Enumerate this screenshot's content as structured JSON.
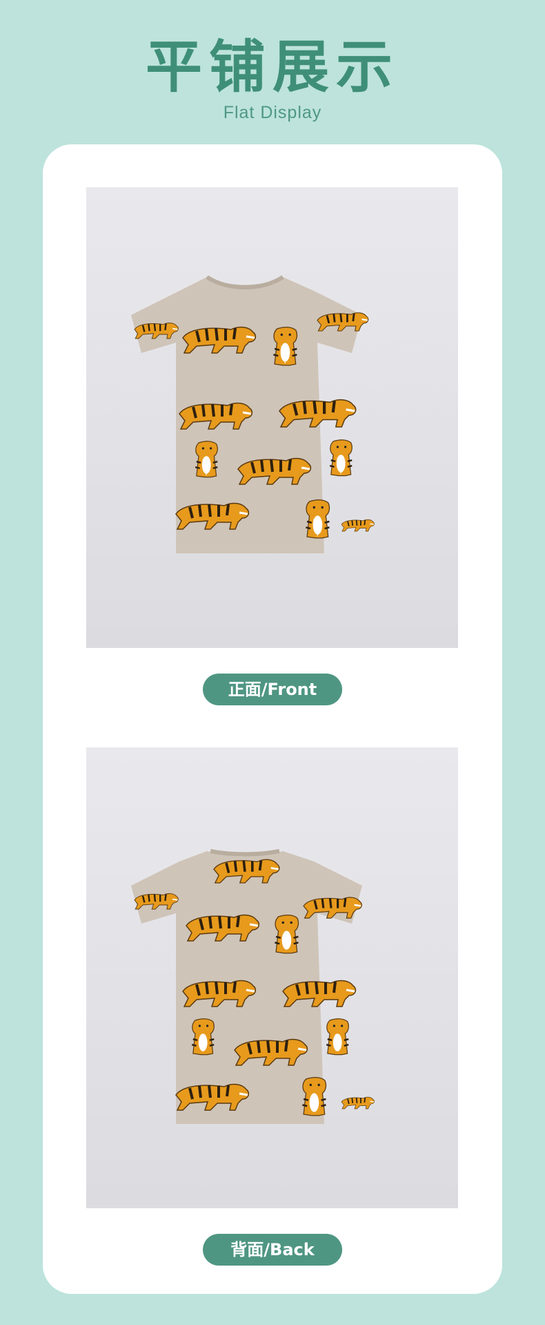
{
  "header": {
    "title_cn": "平铺展示",
    "title_en": "Flat Display"
  },
  "colors": {
    "page_bg": "#bde3dc",
    "card_bg": "#ffffff",
    "accent": "#4f9682",
    "title": "#3f8f78",
    "shirt": "#cfc4b8",
    "tiger_orange": "#e79a1c",
    "photo_bg": "#e6e6ea"
  },
  "gallery": {
    "front_label": "正面/Front",
    "back_label": "背面/Back"
  },
  "images": {
    "front": "tshirt-front-tiger-print-photo",
    "back": "tshirt-back-tiger-print-photo"
  }
}
